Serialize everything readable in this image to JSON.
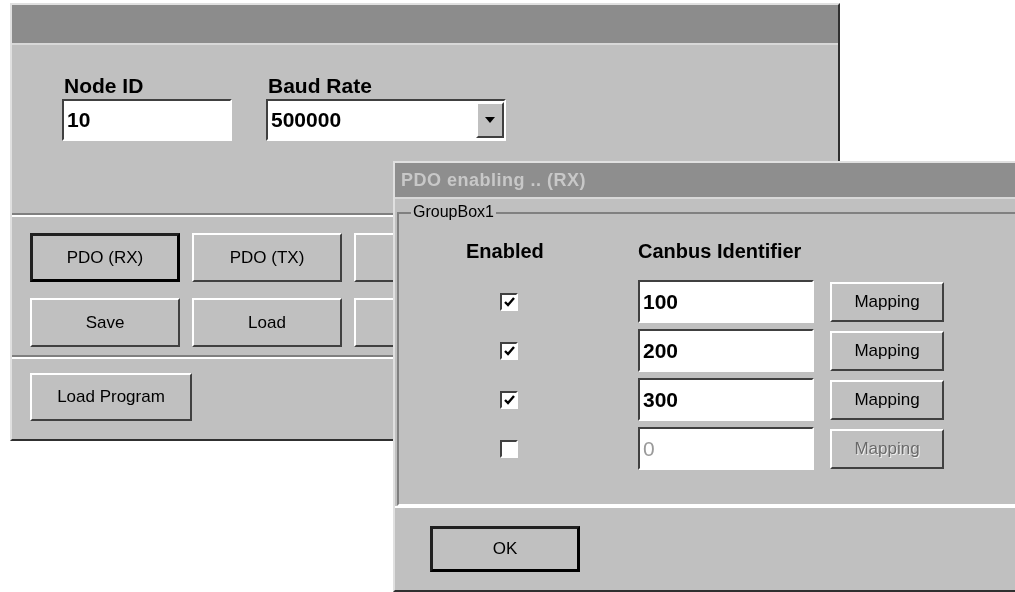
{
  "main_window": {
    "fields": [
      {
        "label": "Node ID",
        "value": "10",
        "kind": "text"
      },
      {
        "label": "Baud Rate",
        "value": "500000",
        "kind": "dropdown"
      }
    ],
    "button_rows": [
      [
        {
          "label": "PDO (RX)",
          "default": true
        },
        {
          "label": "PDO (TX)",
          "default": false
        },
        {
          "default": false
        }
      ],
      [
        {
          "label": "Save",
          "default": false
        },
        {
          "label": "Load",
          "default": false
        },
        {
          "default": false
        }
      ],
      [
        {
          "label": "Load Program",
          "default": false
        }
      ]
    ]
  },
  "dialog": {
    "title": "PDO enabling .. (RX)",
    "group_title": "GroupBox1",
    "columns": [
      "Enabled",
      "Canbus Identifier"
    ],
    "rows": [
      {
        "checked": true,
        "identifier": "100",
        "button": "Mapping"
      },
      {
        "checked": true,
        "identifier": "200",
        "button": "Mapping"
      },
      {
        "checked": true,
        "identifier": "300",
        "button": "Mapping"
      },
      {
        "checked": false,
        "identifier": "0",
        "button": "Mapping"
      }
    ],
    "ok_button": "OK"
  }
}
